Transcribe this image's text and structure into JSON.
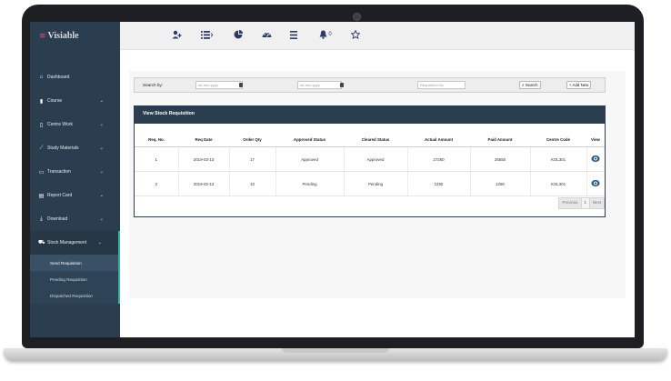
{
  "app": {
    "brand": "Visiable"
  },
  "sidebar": {
    "items": [
      {
        "label": "Dashboard",
        "icon": "home-icon",
        "chevron": false
      },
      {
        "label": "Course",
        "icon": "book-icon",
        "chevron": true
      },
      {
        "label": "Centre Work",
        "icon": "tablet-icon",
        "chevron": true
      },
      {
        "label": "Study Materials",
        "icon": "chart-icon",
        "chevron": true
      },
      {
        "label": "Transaction",
        "icon": "monitor-icon",
        "chevron": true
      },
      {
        "label": "Report Card",
        "icon": "document-icon",
        "chevron": true
      },
      {
        "label": "Download",
        "icon": "download-icon",
        "chevron": true
      },
      {
        "label": "Stock Management",
        "icon": "cart-icon",
        "chevron": true
      }
    ],
    "subitems": [
      {
        "label": "Send Requisition"
      },
      {
        "label": "Pending Requisition"
      },
      {
        "label": "Dispatched Requisition"
      }
    ]
  },
  "topbar": {
    "icons": [
      "add-user-icon",
      "list-icon",
      "pie-chart-icon",
      "dashboard-gauge-icon",
      "menu-icon",
      "bell-icon",
      "star-icon"
    ],
    "notification_count": "0"
  },
  "search": {
    "label": "Search by:",
    "date_from_placeholder": "dd-mm-yyyy",
    "date_to_placeholder": "dd-mm-yyyy",
    "requisition_placeholder": "Requisition No",
    "search_button": "Search",
    "add_button": "+ Add New"
  },
  "requisitions": {
    "title": "View Stock Requisition",
    "columns": [
      "Req. No.",
      "Req Date",
      "Order Qty",
      "Approved Status",
      "Cleared Status",
      "Actual Amount",
      "Paid Amount",
      "Centre Code",
      "View"
    ],
    "rows": [
      [
        "1",
        "2019-03-13",
        "17",
        "Approved",
        "Approved",
        "27250",
        "26650",
        "KOL301"
      ],
      [
        "2",
        "2019-03-13",
        "10",
        "Pending",
        "Pending",
        "1250",
        "1250",
        "KOL301"
      ]
    ],
    "pagination": {
      "previous": "Previous",
      "page": "1",
      "next": "Next"
    }
  }
}
